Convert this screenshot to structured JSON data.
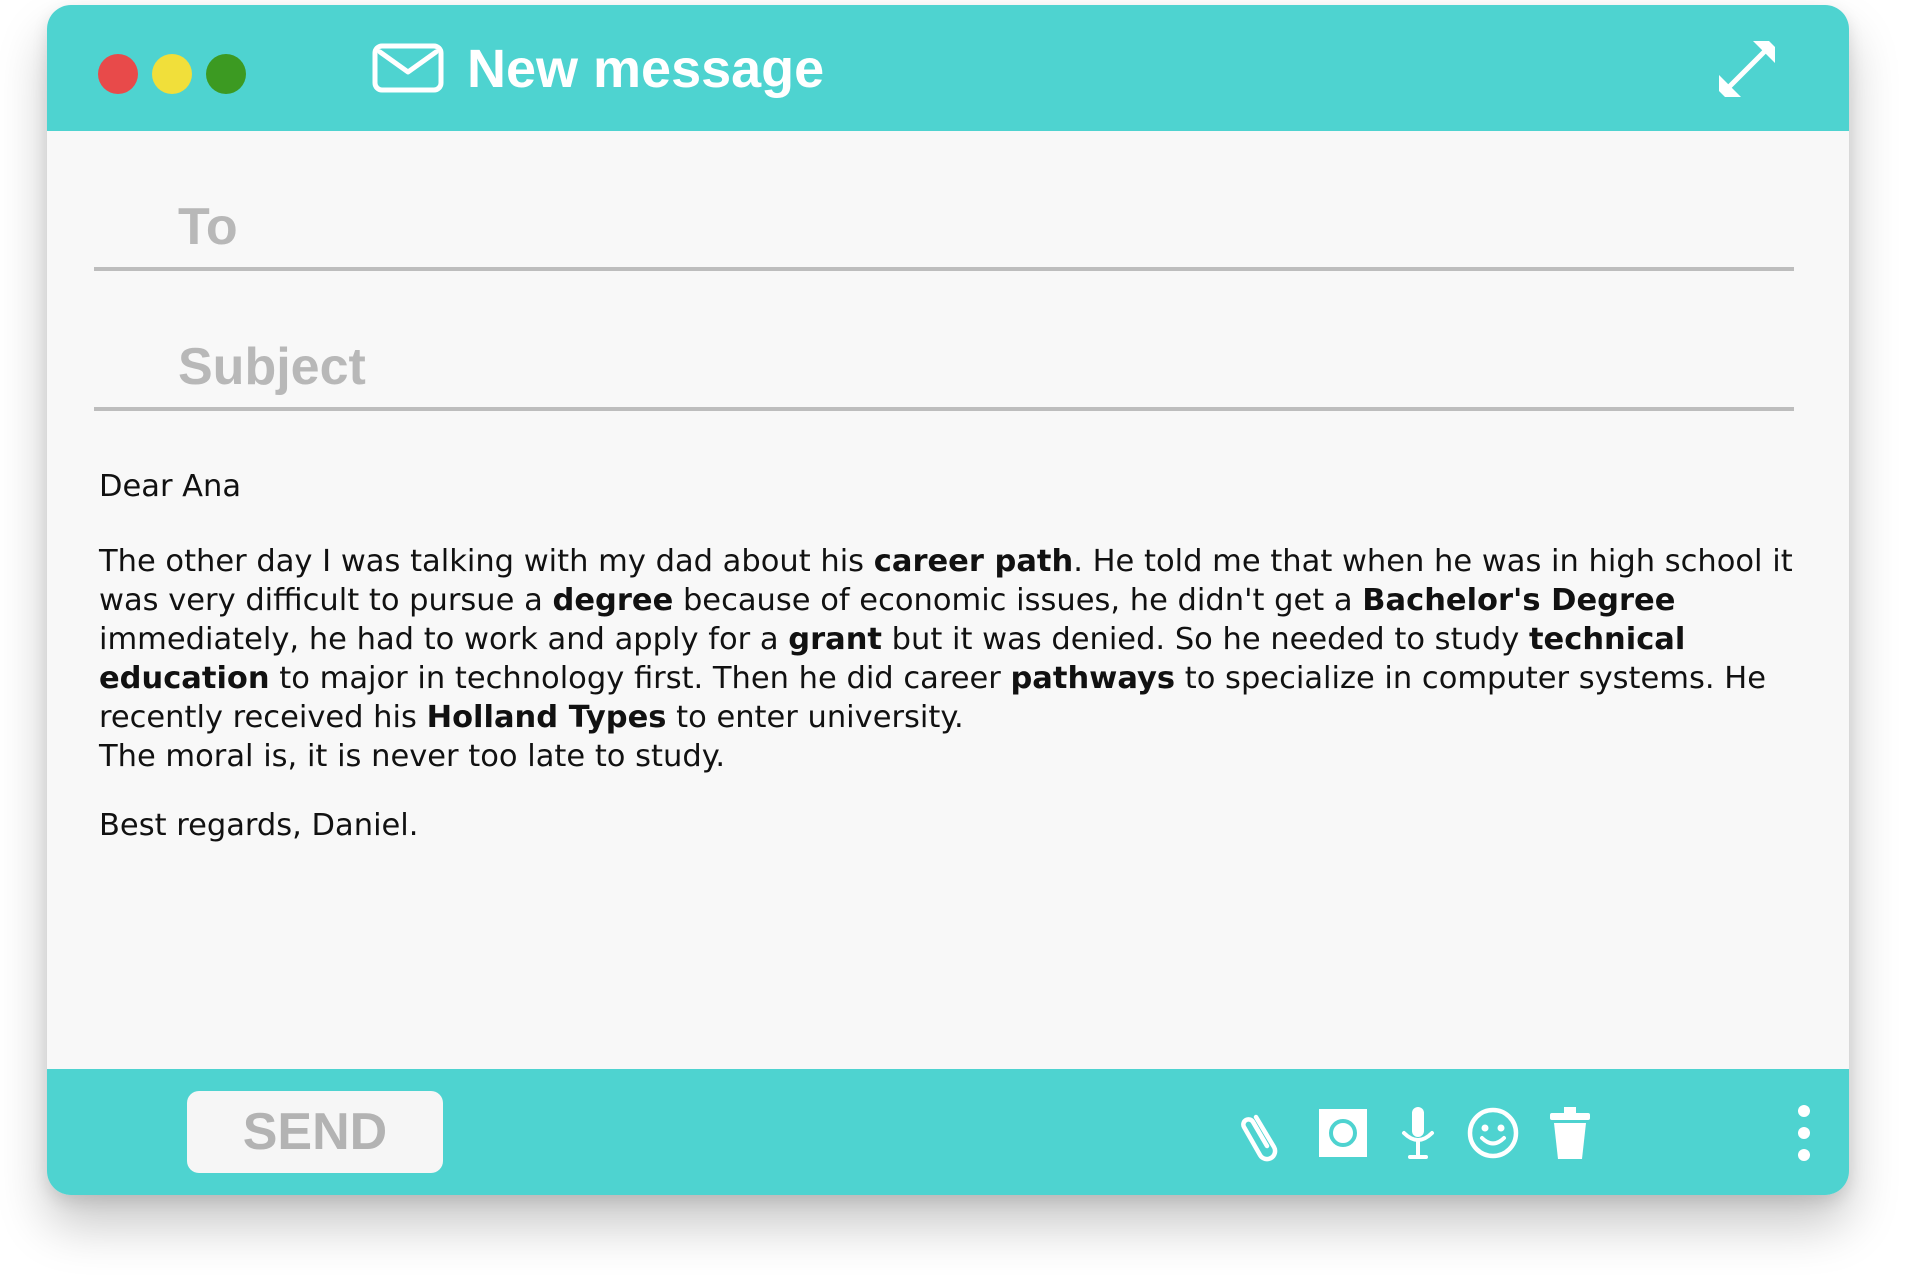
{
  "window": {
    "title": "New message",
    "controls": {
      "close_color": "#e84a4a",
      "minimize_color": "#f1df3a",
      "maximize_color": "#3c9a22"
    },
    "accent_color": "#4ed3d0",
    "icons": {
      "title": "envelope-icon",
      "expand": "expand-icon"
    }
  },
  "compose": {
    "to_placeholder": "To",
    "subject_placeholder": "Subject"
  },
  "message": {
    "greeting": "Dear Ana",
    "body": [
      {
        "t": "The other day I was talking with my dad about his "
      },
      {
        "t": "career path",
        "b": true
      },
      {
        "t": ". He told me that when he was in high school it was very difficult to pursue a "
      },
      {
        "t": "degree",
        "b": true
      },
      {
        "t": " because of economic issues, he didn't get a "
      },
      {
        "t": "Bachelor's Degree",
        "b": true
      },
      {
        "t": " immediately, he had to work and apply for a "
      },
      {
        "t": "grant",
        "b": true
      },
      {
        "t": " but it was denied. So he needed to study "
      },
      {
        "t": "technical education",
        "b": true
      },
      {
        "t": " to major in technology first. Then he did career "
      },
      {
        "t": "pathways",
        "b": true
      },
      {
        "t": " to specialize in computer systems. He recently received his "
      },
      {
        "t": "Holland Types",
        "b": true
      },
      {
        "t": " to enter university."
      }
    ],
    "moral": "The moral is, it is never too late to study.",
    "closing": "Best regards, Daniel."
  },
  "toolbar": {
    "send_label": "SEND",
    "tools": [
      "paperclip-icon",
      "camera-icon",
      "microphone-icon",
      "emoji-icon",
      "trash-icon",
      "more-icon"
    ]
  }
}
